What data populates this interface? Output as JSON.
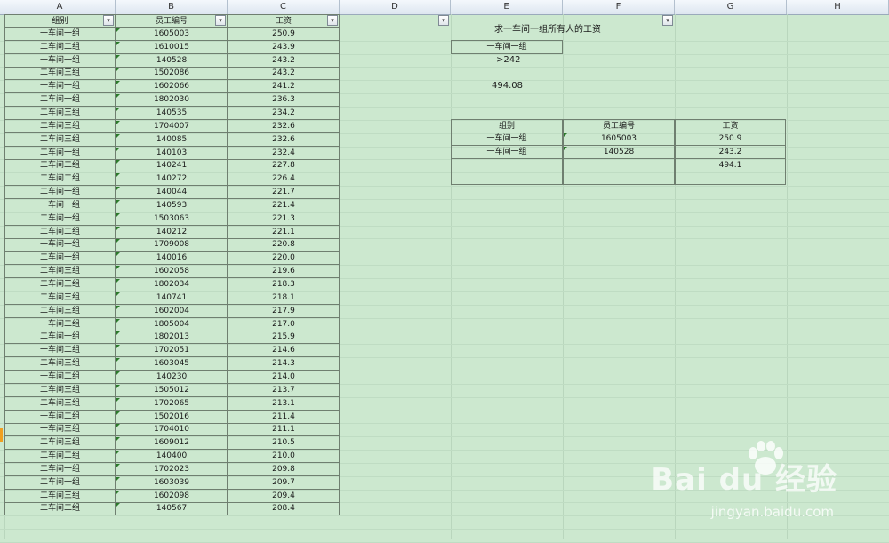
{
  "columns": [
    "A",
    "B",
    "C",
    "D",
    "E",
    "F",
    "G",
    "H"
  ],
  "main_table": {
    "headers": [
      "组别",
      "员工编号",
      "工资"
    ],
    "rows": [
      [
        "一车间一组",
        "1605003",
        "250.9"
      ],
      [
        "二车间二组",
        "1610015",
        "243.9"
      ],
      [
        "一车间一组",
        "140528",
        "243.2"
      ],
      [
        "二车间三组",
        "1502086",
        "243.2"
      ],
      [
        "一车间一组",
        "1602066",
        "241.2"
      ],
      [
        "二车间一组",
        "1802030",
        "236.3"
      ],
      [
        "二车间三组",
        "140535",
        "234.2"
      ],
      [
        "二车间三组",
        "1704007",
        "232.6"
      ],
      [
        "二车间三组",
        "140085",
        "232.6"
      ],
      [
        "二车间一组",
        "140103",
        "232.4"
      ],
      [
        "二车间二组",
        "140241",
        "227.8"
      ],
      [
        "二车间二组",
        "140272",
        "226.4"
      ],
      [
        "二车间一组",
        "140044",
        "221.7"
      ],
      [
        "一车间一组",
        "140593",
        "221.4"
      ],
      [
        "二车间一组",
        "1503063",
        "221.3"
      ],
      [
        "二车间二组",
        "140212",
        "221.1"
      ],
      [
        "一车间一组",
        "1709008",
        "220.8"
      ],
      [
        "二车间一组",
        "140016",
        "220.0"
      ],
      [
        "二车间三组",
        "1602058",
        "219.6"
      ],
      [
        "二车间三组",
        "1802034",
        "218.3"
      ],
      [
        "二车间三组",
        "140741",
        "218.1"
      ],
      [
        "二车间三组",
        "1602004",
        "217.9"
      ],
      [
        "一车间二组",
        "1805004",
        "217.0"
      ],
      [
        "二车间一组",
        "1802013",
        "215.9"
      ],
      [
        "一车间二组",
        "1702051",
        "214.6"
      ],
      [
        "二车间三组",
        "1603045",
        "214.3"
      ],
      [
        "一车间二组",
        "140230",
        "214.0"
      ],
      [
        "二车间三组",
        "1505012",
        "213.7"
      ],
      [
        "二车间三组",
        "1702065",
        "213.1"
      ],
      [
        "一车间二组",
        "1502016",
        "211.4"
      ],
      [
        "一车间三组",
        "1704010",
        "211.1"
      ],
      [
        "二车间三组",
        "1609012",
        "210.5"
      ],
      [
        "二车间二组",
        "140400",
        "210.0"
      ],
      [
        "二车间一组",
        "1702023",
        "209.8"
      ],
      [
        "二车间一组",
        "1603039",
        "209.7"
      ],
      [
        "二车间三组",
        "1602098",
        "209.4"
      ],
      [
        "二车间二组",
        "140567",
        "208.4"
      ]
    ]
  },
  "title": "求一车间一组所有人的工资",
  "criteria": {
    "label": "一车间一组",
    "condition": ">242",
    "result": "494.08"
  },
  "result_table": {
    "headers": [
      "组别",
      "员工编号",
      "工资"
    ],
    "rows": [
      [
        "一车间一组",
        "1605003",
        "250.9"
      ],
      [
        "一车间一组",
        "140528",
        "243.2"
      ],
      [
        "",
        "",
        "494.1"
      ],
      [
        "",
        "",
        ""
      ]
    ]
  },
  "filter_icon": "▾",
  "watermark": {
    "brand": "Bai du 经验",
    "url": "jingyan.baidu.com"
  },
  "colors": {
    "sheet_bg": "#cce8cf",
    "cell_border": "#6f7f70",
    "error_triangle": "#2b7a2b"
  }
}
